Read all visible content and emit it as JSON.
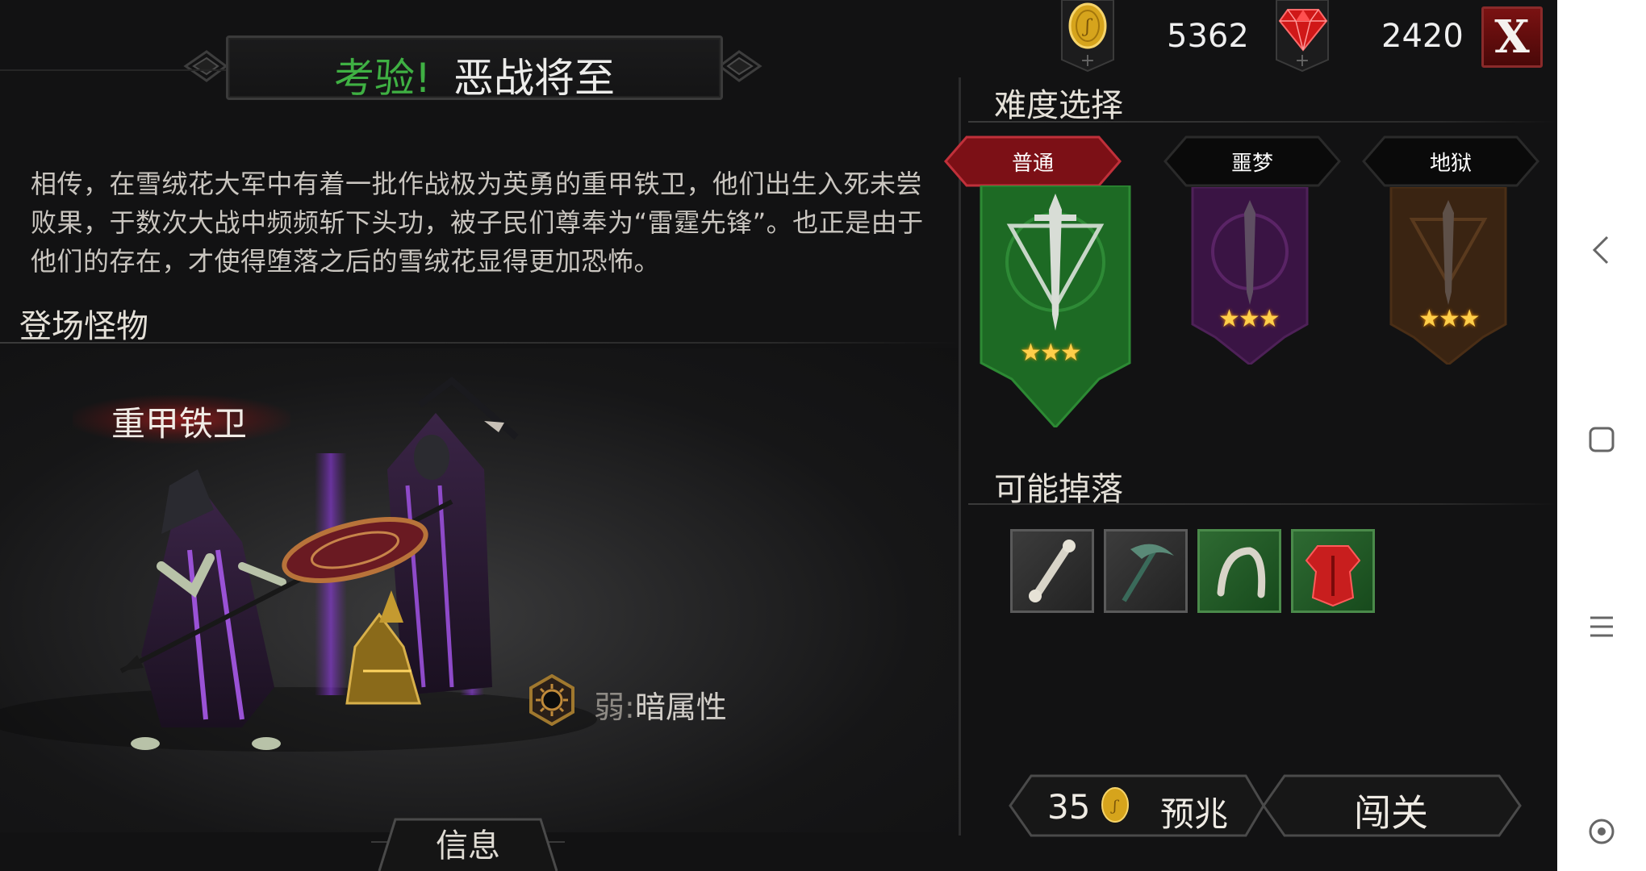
{
  "title": {
    "prefix": "考验!",
    "name": "恶战将至"
  },
  "description": "相传，在雪绒花大军中有着一批作战极为英勇的重甲铁卫，他们出生入死未尝败果，于数次大战中频频斩下头功，被子民们尊奉为“雷霆先锋”。也正是由于他们的存在，才使得堕落之后的雪绒花显得更加恐怖。",
  "sections": {
    "monsters": "登场怪物",
    "difficulty": "难度选择",
    "drops": "可能掉落"
  },
  "monster": {
    "name": "重甲铁卫",
    "weak_label": "弱:",
    "weak_value": "暗属性"
  },
  "info_tab": "信息",
  "currency": {
    "coins": "5362",
    "gems": "2420",
    "close": "X"
  },
  "difficulty_options": [
    {
      "label": "普通",
      "stars": "★★★",
      "selected": true,
      "color": "#1f7a2a"
    },
    {
      "label": "噩梦",
      "stars": "★★★",
      "selected": false,
      "color": "#4a1a52"
    },
    {
      "label": "地狱",
      "stars": "★★★",
      "selected": false,
      "color": "#4a2a12"
    }
  ],
  "drops": [
    {
      "icon": "bone-icon",
      "rarity": "common"
    },
    {
      "icon": "scythe-icon",
      "rarity": "common"
    },
    {
      "icon": "claw-icon",
      "rarity": "uncommon"
    },
    {
      "icon": "red-armor-icon",
      "rarity": "uncommon"
    }
  ],
  "omen": {
    "cost": "35",
    "label": "预兆"
  },
  "start_button": "闯关",
  "android_nav": {
    "back": "back-icon",
    "home": "home-icon",
    "menu": "menu-icon",
    "assistant": "assistant-icon"
  }
}
